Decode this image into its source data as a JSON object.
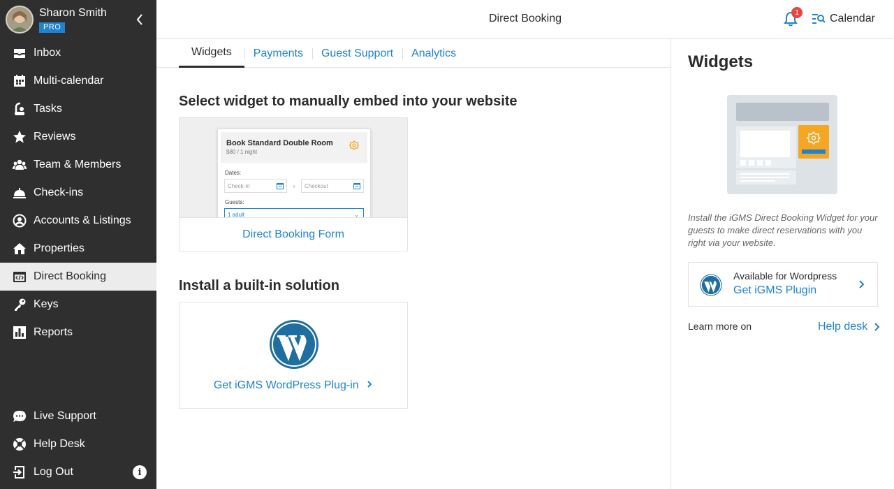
{
  "user": {
    "name": "Sharon Smith",
    "plan_badge": "PRO"
  },
  "sidebar": {
    "items": [
      {
        "label": "Inbox",
        "icon": "inbox-icon"
      },
      {
        "label": "Multi-calendar",
        "icon": "calendar-icon"
      },
      {
        "label": "Tasks",
        "icon": "vacuum-icon"
      },
      {
        "label": "Reviews",
        "icon": "star-icon"
      },
      {
        "label": "Team & Members",
        "icon": "team-icon"
      },
      {
        "label": "Check-ins",
        "icon": "service-bell-icon"
      },
      {
        "label": "Accounts & Listings",
        "icon": "account-icon"
      },
      {
        "label": "Properties",
        "icon": "home-icon"
      },
      {
        "label": "Direct Booking",
        "icon": "code-window-icon",
        "active": true
      },
      {
        "label": "Keys",
        "icon": "key-icon"
      },
      {
        "label": "Reports",
        "icon": "bar-chart-icon"
      }
    ],
    "bottom_items": [
      {
        "label": "Live Support",
        "icon": "chat-icon"
      },
      {
        "label": "Help Desk",
        "icon": "lifebuoy-icon"
      },
      {
        "label": "Log Out",
        "icon": "logout-icon"
      }
    ],
    "info": "i"
  },
  "header": {
    "title": "Direct Booking",
    "notification_count": "1",
    "calendar_label": "Calendar"
  },
  "tabs": [
    {
      "label": "Widgets",
      "active": true
    },
    {
      "label": "Payments"
    },
    {
      "label": "Guest Support"
    },
    {
      "label": "Analytics"
    }
  ],
  "main": {
    "widgets_heading": "Select widget to manually embed into your website",
    "widget_card": {
      "label": "Direct Booking Form",
      "preview": {
        "room_title": "Book Standard Double Room",
        "price": "$80 / 1 night",
        "dates_label": "Dates:",
        "checkin_placeholder": "Check-in",
        "checkout_placeholder": "Checkout",
        "arrow": "›",
        "guests_label": "Guests:",
        "guests_value": "1 adult"
      }
    },
    "builtin_heading": "Install a built-in solution",
    "wp_card": {
      "link": "Get iGMS WordPress Plug-in"
    }
  },
  "right_panel": {
    "title": "Widgets",
    "description": "Install the iGMS Direct Booking Widget for your guests to make direct reservations with you right via your website.",
    "plugin_box": {
      "small": "Available for Wordpress",
      "link": "Get iGMS Plugin"
    },
    "learn_more": "Learn more on",
    "help_link": "Help desk"
  },
  "colors": {
    "accent": "#1f83d2",
    "sidebar_bg": "#2f2f2f",
    "badge_red": "#e8453c",
    "logo_orange": "#f5a623"
  }
}
